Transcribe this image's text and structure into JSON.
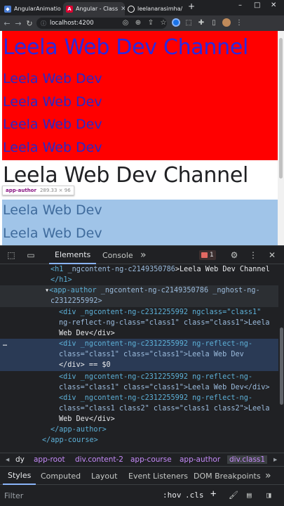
{
  "browser": {
    "tabs": [
      {
        "label": "AngularAnimatio",
        "favicon_color": "#4a7bd0",
        "favicon_glyph": "◆",
        "active": false
      },
      {
        "label": "Angular - Class",
        "favicon_color": "#dd0031",
        "favicon_glyph": "A",
        "active": true
      },
      {
        "label": "leelanarasimha/",
        "favicon_color": "#ffffff",
        "favicon_glyph": "●",
        "active": false
      }
    ],
    "new_tab": "+",
    "window_controls": [
      "–",
      "□",
      "✕"
    ],
    "url": "localhost:4200",
    "nav": {
      "back": "←",
      "forward": "→",
      "reload": "↻"
    }
  },
  "page": {
    "red_heading": "Leela Web Dev Channel",
    "red_lines": [
      "Leela Web Dev",
      "Leela Web Dev",
      "Leela Web Dev",
      "Leela Web Dev"
    ],
    "black_heading": "Leela Web Dev Channel",
    "tooltip": {
      "name": "app-author",
      "dims": "289.33 × 96"
    },
    "hl_lines": [
      "Leela Web Dev",
      "Leela Web Dev"
    ],
    "colors": {
      "red": "#ff0000",
      "highlight": "#a0c4e8",
      "heading_blue": "#2a2ae0"
    }
  },
  "devtools": {
    "tabs": {
      "elements": "Elements",
      "console": "Console",
      "more": "»"
    },
    "error_count": "1",
    "dom": {
      "h1_open": "<h1",
      "h1_attr": " _ngcontent-ng-c2149350786",
      "h1_text": ">Leela Web Dev Channel",
      "h1_close": "</h1>",
      "author_open": "<app-author",
      "author_attr1": " _ngcontent-ng-c2149350786",
      "author_attr2": " _nghost-ng-",
      "author_attr2b": "c2312255992>",
      "div1_l1": "<div _ngcontent-ng-c2312255992 ngclass=\"class1\"",
      "div1_l2": "ng-reflect-ng-class=\"class1\" class=\"class1\">Leela",
      "div1_l3": "Web Dev</div>",
      "div2_l1": "<div _ngcontent-ng-c2312255992 ng-reflect-ng-",
      "div2_l2": "class=\"class1\" class=\"class1\">Leela Web Dev",
      "div2_l3": "</div> == $0",
      "div3_l1": "<div _ngcontent-ng-c2312255992 ng-reflect-ng-",
      "div3_l2": "class=\"class1\" class=\"class1\">Leela Web Dev</div>",
      "div4_l1": "<div _ngcontent-ng-c2312255992 ng-reflect-ng-",
      "div4_l2": "class=\"class1 class2\" class=\"class1 class2\">Leela",
      "div4_l3": "Web Dev</div>",
      "author_close": "</app-author>",
      "course_close": "</app-course>",
      "ellipsis": "…"
    },
    "breadcrumbs": [
      "◂",
      "dy",
      "app-root",
      "div.content-2",
      "app-course",
      "app-author",
      "div.class1"
    ],
    "sub_tabs": [
      "Styles",
      "Computed",
      "Layout",
      "Event Listeners",
      "DOM Breakpoints",
      "»"
    ],
    "filter_placeholder": "Filter",
    "filter_tools": [
      ":hov",
      ".cls",
      "+"
    ]
  }
}
